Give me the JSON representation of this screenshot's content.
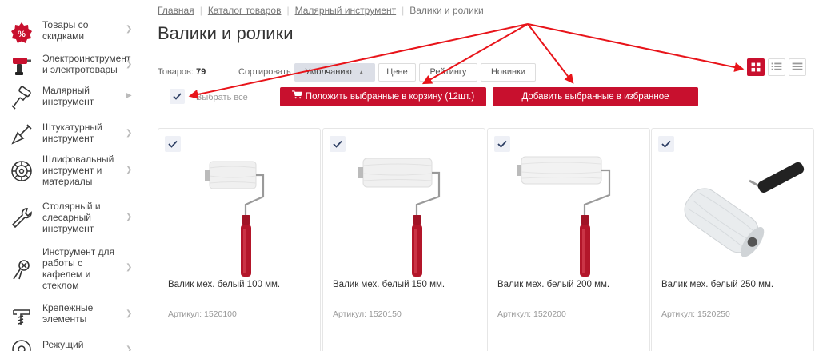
{
  "sidebar": {
    "items": [
      {
        "label": "Товары со скидками",
        "icon": "discount-icon"
      },
      {
        "label": "Электроинструмент и электротовары",
        "icon": "drill-icon"
      },
      {
        "label": "Малярный инструмент",
        "icon": "paint-roller-icon",
        "active": true
      },
      {
        "label": "Штукатурный инструмент",
        "icon": "trowel-icon"
      },
      {
        "label": "Шлифовальный инструмент и материалы",
        "icon": "grinding-disc-icon"
      },
      {
        "label": "Столярный и слесарный инструмент",
        "icon": "wrench-icon"
      },
      {
        "label": "Инструмент для работы с кафелем и стеклом",
        "icon": "tile-cutter-icon"
      },
      {
        "label": "Крепежные элементы",
        "icon": "fastener-icon"
      },
      {
        "label": "Режущий",
        "icon": "saw-blade-icon"
      }
    ]
  },
  "breadcrumb": {
    "items": [
      "Главная",
      "Каталог товаров",
      "Малярный инструмент",
      "Валики и ролики"
    ]
  },
  "page": {
    "title": "Валики и ролики"
  },
  "toolbar": {
    "count_label": "Товаров:",
    "count_value": "79",
    "sort_label": "Сортировать по:",
    "sort_options": [
      {
        "label": "Умолчанию",
        "active": true
      },
      {
        "label": "Цене"
      },
      {
        "label": "Рейтингу"
      },
      {
        "label": "Новинки"
      }
    ],
    "view_modes": [
      {
        "name": "grid-view-icon",
        "active": true
      },
      {
        "name": "list-view-icon"
      },
      {
        "name": "compact-list-view-icon"
      }
    ]
  },
  "actions": {
    "select_all": "Выбрать все",
    "add_to_cart": "Положить выбранные в корзину (12шт.)",
    "add_to_favorites": "Добавить выбранные в избранное"
  },
  "products": [
    {
      "title": "Валик мех. белый 100 мм.",
      "sku": "Артикул: 1520100",
      "checked": true
    },
    {
      "title": "Валик мех. белый 150 мм.",
      "sku": "Артикул: 1520150",
      "checked": true
    },
    {
      "title": "Валик мех. белый 200 мм.",
      "sku": "Артикул: 1520200",
      "checked": true
    },
    {
      "title": "Валик мех. белый 250 мм.",
      "sku": "Артикул: 1520250",
      "checked": true
    }
  ],
  "colors": {
    "accent": "#c8102e",
    "annotation_arrow": "#e8141a",
    "handle": "#b3162a"
  }
}
